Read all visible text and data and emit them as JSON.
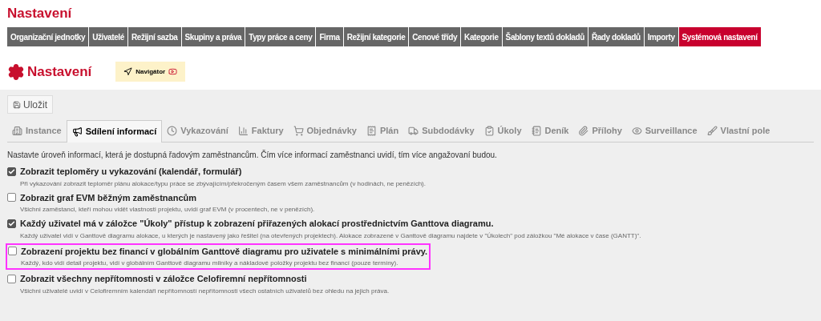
{
  "page_title": "Nastavení",
  "nav": [
    {
      "label": "Organizační jednotky",
      "selected": false
    },
    {
      "label": "Uživatelé",
      "selected": false
    },
    {
      "label": "Režijní sazba",
      "selected": false
    },
    {
      "label": "Skupiny a práva",
      "selected": false
    },
    {
      "label": "Typy práce a ceny",
      "selected": false
    },
    {
      "label": "Firma",
      "selected": false
    },
    {
      "label": "Režijní kategorie",
      "selected": false
    },
    {
      "label": "Cenové třídy",
      "selected": false
    },
    {
      "label": "Kategorie",
      "selected": false
    },
    {
      "label": "Šablony textů dokladů",
      "selected": false
    },
    {
      "label": "Řady dokladů",
      "selected": false
    },
    {
      "label": "Importy",
      "selected": false
    },
    {
      "label": "Systémová nastavení",
      "selected": true
    }
  ],
  "header": {
    "title": "Nastavení",
    "navigator_button": "Navigátor"
  },
  "save_button": "Uložit",
  "tabs": [
    {
      "label": "Instance",
      "selected": false
    },
    {
      "label": "Sdílení informací",
      "selected": true
    },
    {
      "label": "Vykazování",
      "selected": false
    },
    {
      "label": "Faktury",
      "selected": false
    },
    {
      "label": "Objednávky",
      "selected": false
    },
    {
      "label": "Plán",
      "selected": false
    },
    {
      "label": "Subdodávky",
      "selected": false
    },
    {
      "label": "Úkoly",
      "selected": false
    },
    {
      "label": "Deník",
      "selected": false
    },
    {
      "label": "Přílohy",
      "selected": false
    },
    {
      "label": "Surveillance",
      "selected": false
    },
    {
      "label": "Vlastní pole",
      "selected": false
    }
  ],
  "intro": "Nastavte úroveň informací, která je dostupná řadovým zaměstnancům. Čím více informací zaměstnanci uvidí, tím více angažovaní budou.",
  "options": [
    {
      "title": "Zobrazit teploměry u vykazování (kalendář, formulář)",
      "description": "Při vykazování zobrazit teploměr plánu alokace/typu práce se zbývajícím/překročeným časem všem zaměstnancům (v hodinách, ne penězích).",
      "checked": true,
      "highlighted": false
    },
    {
      "title": "Zobrazit graf EVM běžným zaměstnancům",
      "description": "Všichni zaměstanci, kteří mohou vidět vlastnosti projektu, uvidí graf EVM (v procentech, ne v penězích).",
      "checked": false,
      "highlighted": false
    },
    {
      "title": "Každý uživatel má v záložce \"Úkoly\" přístup k zobrazení přiřazených alokací prostřednictvím Ganttova diagramu.",
      "description": "Každý uživatel vidí v Ganttově diagramu alokace, u kterých je nastavený jako řešitel (na otevřených projektech). Alokace zobrazené v Ganttově diagramu najdete v \"Úkolech\" pod záložkou \"Mé alokace v čase (GANTT)\".",
      "checked": true,
      "highlighted": false
    },
    {
      "title": "Zobrazení projektu bez financí v globálním Ganttově diagramu pro uživatele s minimálními právy.",
      "description": "Každý, kdo vidí detail projektu, vidí v globálním Ganttově diagramu milníky a nákladové položky projektu bez financí (pouze termíny).",
      "checked": false,
      "highlighted": true
    },
    {
      "title": "Zobrazit všechny nepřítomnosti v záložce Celofiremní nepřítomnosti",
      "description": "Všichni uživatelé uvidí v Celofiremním kalendáři nepřítomností nepřítomnosti všech ostatních uživatelů bez ohledu na jejich práva.",
      "checked": false,
      "highlighted": false
    }
  ]
}
